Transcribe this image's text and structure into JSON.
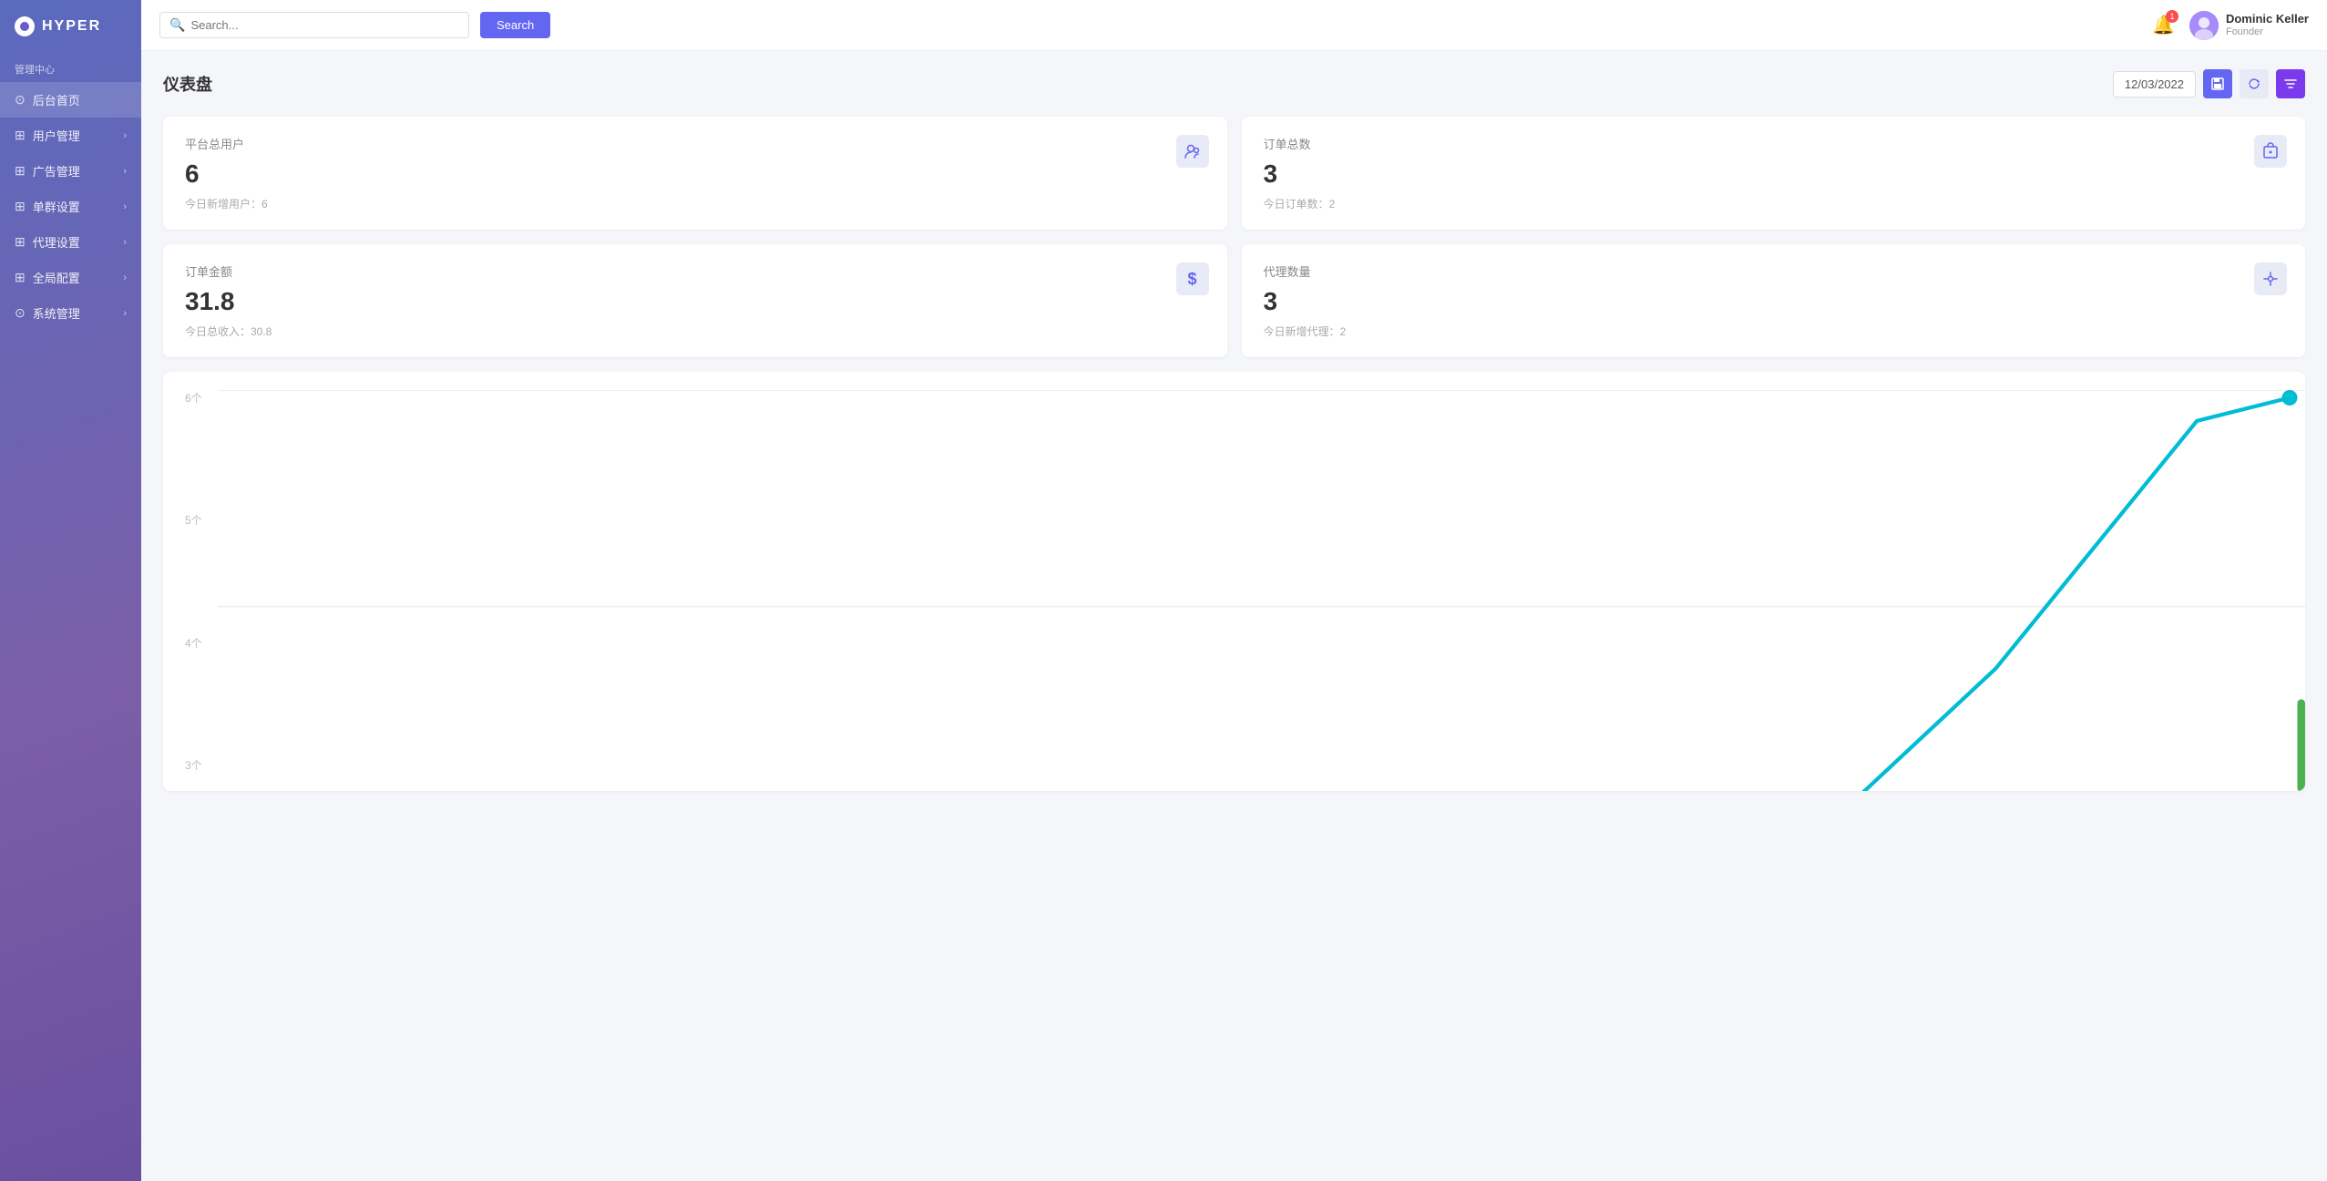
{
  "sidebar": {
    "logo_text": "HYPER",
    "admin_label": "管理中心",
    "items": [
      {
        "id": "home",
        "label": "后台首页",
        "icon": "⊙",
        "arrow": false,
        "active": true
      },
      {
        "id": "users",
        "label": "用户管理",
        "icon": "⊞",
        "arrow": true
      },
      {
        "id": "ads",
        "label": "广告管理",
        "icon": "⊞",
        "arrow": true
      },
      {
        "id": "group",
        "label": "单群设置",
        "icon": "⊞",
        "arrow": true
      },
      {
        "id": "agent",
        "label": "代理设置",
        "icon": "⊞",
        "arrow": true
      },
      {
        "id": "global",
        "label": "全局配置",
        "icon": "⊞",
        "arrow": true
      },
      {
        "id": "system",
        "label": "系统管理",
        "icon": "⊙",
        "arrow": true
      }
    ]
  },
  "header": {
    "search_placeholder": "Search...",
    "search_btn": "Search",
    "bell_count": "1",
    "user_name": "Dominic Keller",
    "user_role": "Founder"
  },
  "page": {
    "title": "仪表盘",
    "date": "12/03/2022"
  },
  "stats": [
    {
      "id": "total-users",
      "label": "平台总用户",
      "value": "6",
      "sub": "今日新增用户：6",
      "icon": "👥"
    },
    {
      "id": "total-orders",
      "label": "订单总数",
      "value": "3",
      "sub": "今日订单数：2",
      "icon": "🛒"
    },
    {
      "id": "order-amount",
      "label": "订单金额",
      "value": "31.8",
      "sub": "今日总收入：30.8",
      "icon": "$"
    },
    {
      "id": "agent-count",
      "label": "代理数量",
      "value": "3",
      "sub": "今日新增代理：2",
      "icon": "⇄"
    }
  ],
  "chart": {
    "y_labels": [
      "6个",
      "5个",
      "4个",
      "3个"
    ],
    "line_color": "#00bcd4",
    "accent_color": "#4caf50"
  }
}
